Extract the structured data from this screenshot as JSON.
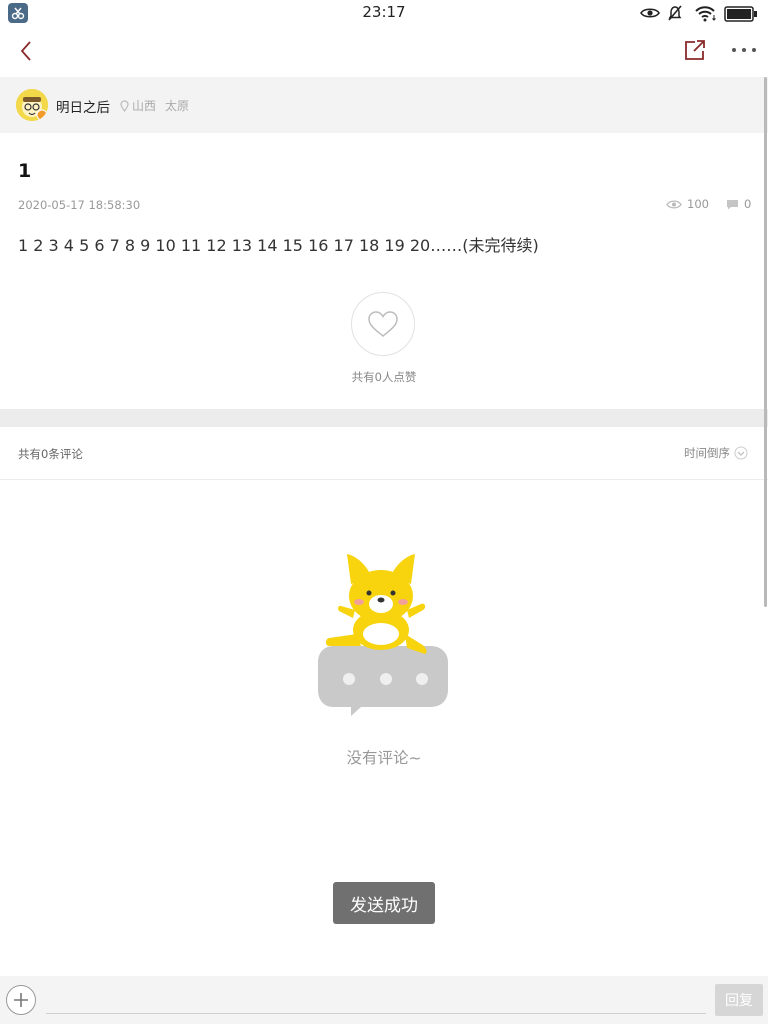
{
  "status_bar": {
    "time": "23:17",
    "icons": [
      "app-badge-icon",
      "eye-icon",
      "mute-icon",
      "wifi-icon",
      "battery-icon"
    ]
  },
  "nav": {
    "icons": [
      "back-icon",
      "share-icon",
      "more-icon"
    ]
  },
  "author": {
    "name": "明日之后",
    "location": [
      "山西",
      "太原"
    ]
  },
  "post": {
    "title": "1",
    "timestamp": "2020-05-17 18:58:30",
    "views": "100",
    "comments": "0",
    "body": "1 2 3 4 5 6 7 8 9 10 11 12 13 14 15 16 17 18 19 20……(未完待续)"
  },
  "likes": {
    "summary": "共有0人点赞"
  },
  "comments_section": {
    "total": "共有0条评论",
    "sort_label": "时间倒序",
    "empty_text": "没有评论~"
  },
  "toast": "发送成功",
  "bottom_bar": {
    "reply_value": "",
    "reply_label": "回复"
  },
  "colors": {
    "accent": "#8a2a2a",
    "mascot_yellow": "#f7d40e",
    "toast_bg": "#707070"
  }
}
